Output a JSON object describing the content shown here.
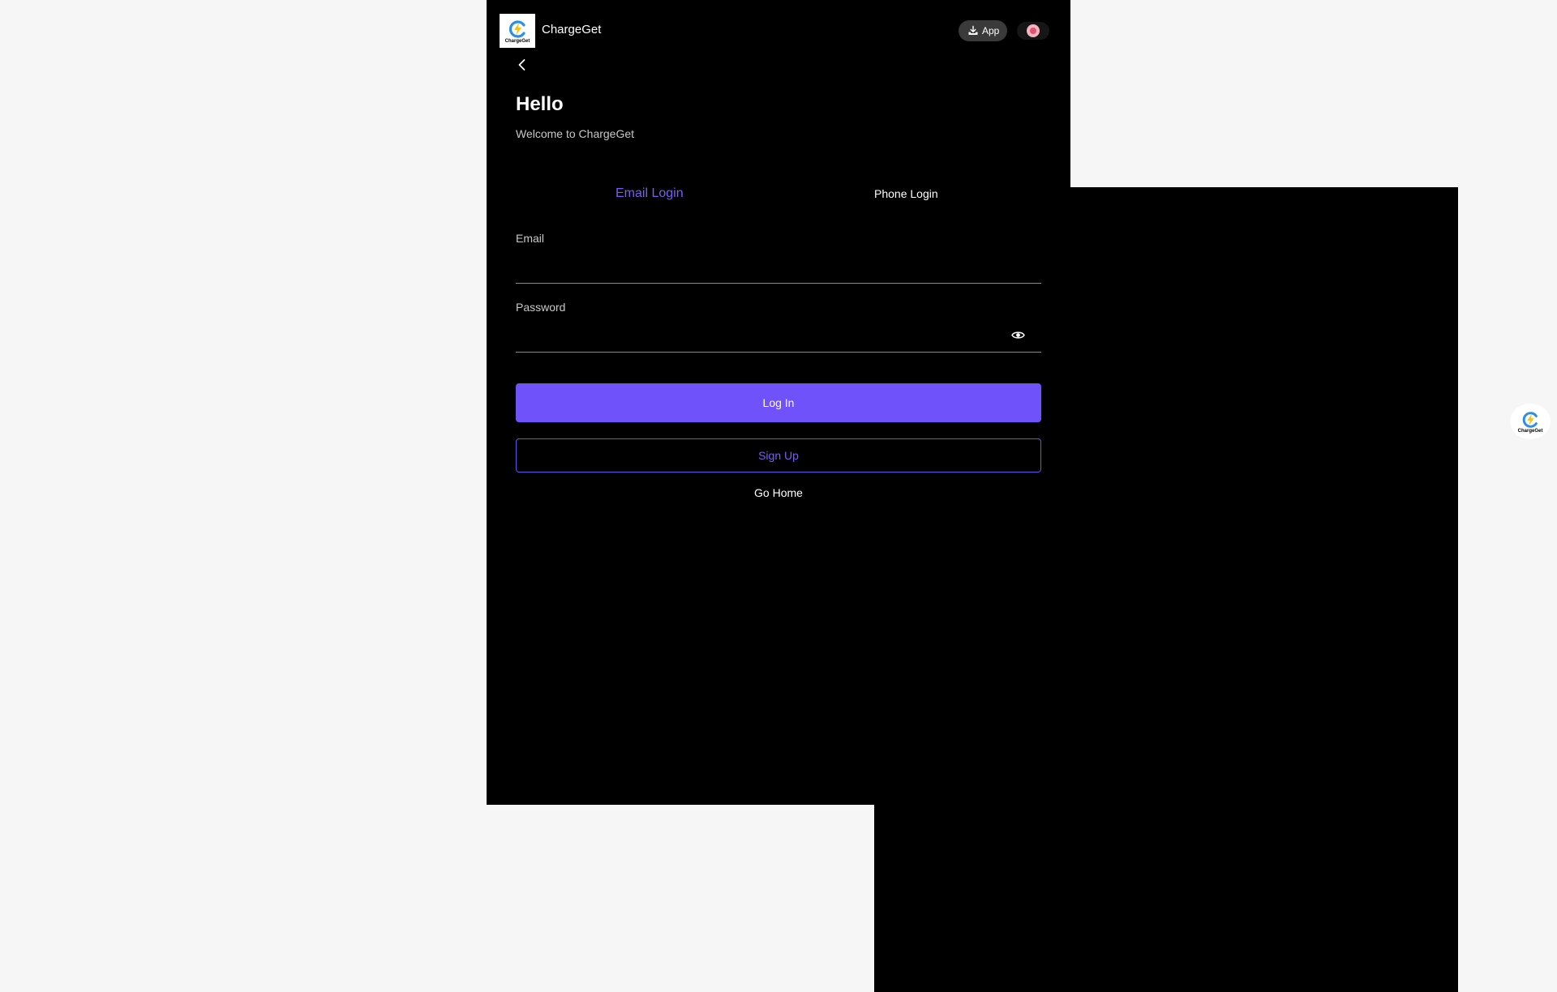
{
  "header": {
    "logo_text": "ChargeGet",
    "brand_name": "ChargeGet",
    "app_button_label": "App",
    "app_icon": "download-tray-icon",
    "language_icon": "flag-icon"
  },
  "hero": {
    "title": "Hello",
    "subtitle": "Welcome to ChargeGet"
  },
  "tabs": [
    {
      "label": "Email Login",
      "active": true
    },
    {
      "label": "Phone Login",
      "active": false
    }
  ],
  "form": {
    "email_label": "Email",
    "email_value": "",
    "password_label": "Password",
    "password_value": ""
  },
  "actions": {
    "login_label": "Log In",
    "signup_label": "Sign Up",
    "go_home_label": "Go Home"
  },
  "float_widget": {
    "logo_text": "ChargeGet"
  },
  "colors": {
    "accent": "#7052fa",
    "accent_text": "#7b5cf5",
    "background": "#000000",
    "page_background": "#f6f6f6"
  }
}
